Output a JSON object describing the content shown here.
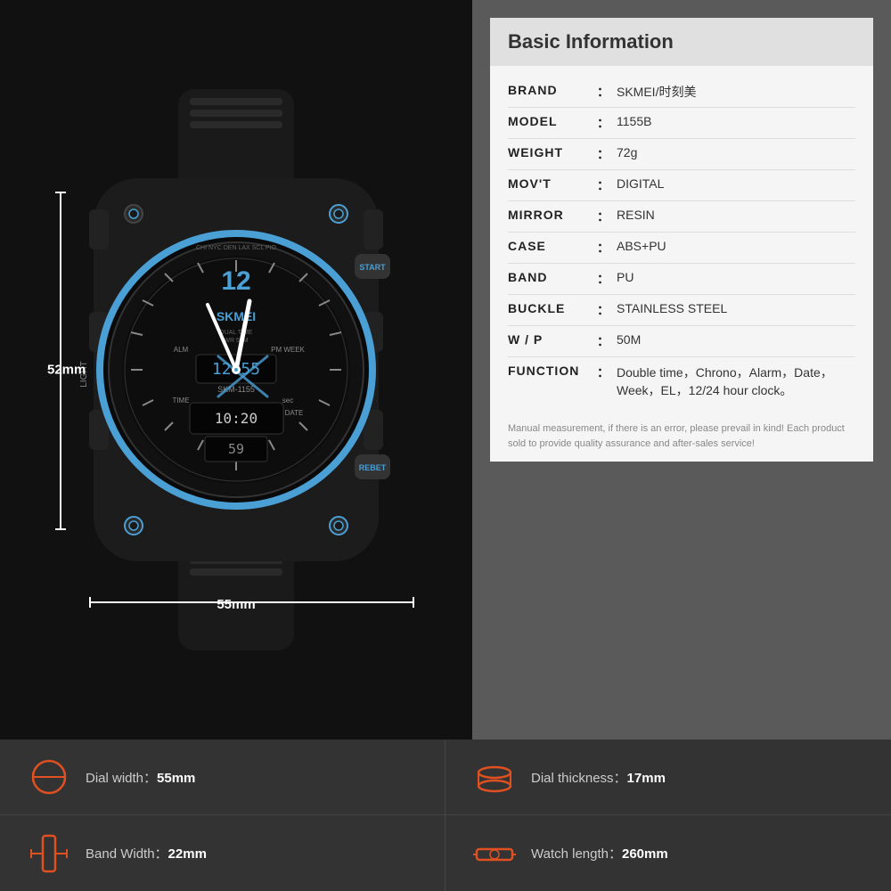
{
  "header": {
    "title": "Basic Information"
  },
  "specs": [
    {
      "label": "BRAND",
      "value": "SKMEI/时刻美"
    },
    {
      "label": "MODEL",
      "value": "1155B"
    },
    {
      "label": "WEIGHT",
      "value": "72g"
    },
    {
      "label": "MOV'T",
      "value": "DIGITAL"
    },
    {
      "label": "MIRROR",
      "value": "RESIN"
    },
    {
      "label": "CASE",
      "value": "ABS+PU"
    },
    {
      "label": "BAND",
      "value": "PU"
    },
    {
      "label": "BUCKLE",
      "value": "STAINLESS STEEL"
    },
    {
      "label": "W / P",
      "value": "50M"
    },
    {
      "label": "FUNCTION",
      "value": "Double time，Chrono，Alarm，Date，Week，EL，12/24 hour clock。"
    }
  ],
  "note": "Manual measurement, if there is an error, please prevail in kind!\nEach product sold to provide quality assurance and after-sales service!",
  "dimensions": {
    "height_label": "52mm",
    "width_label": "55mm"
  },
  "stats": [
    {
      "label": "Dial width：",
      "value": "55mm",
      "icon": "dial-width"
    },
    {
      "label": "Dial thickness：",
      "value": "17mm",
      "icon": "dial-thickness"
    },
    {
      "label": "Band Width：",
      "value": "22mm",
      "icon": "band-width"
    },
    {
      "label": "Watch length：",
      "value": "260mm",
      "icon": "watch-length"
    }
  ],
  "colors": {
    "accent": "#4a9fd4",
    "background": "#111111",
    "card_bg": "#5a5a5a",
    "header_bg": "#e0e0e0",
    "body_bg": "#f5f5f5"
  }
}
